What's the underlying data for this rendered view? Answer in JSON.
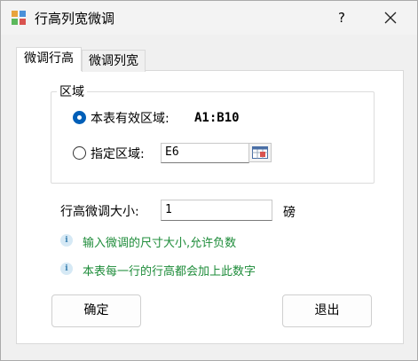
{
  "window": {
    "title": "行高列宽微调",
    "help_label": "?"
  },
  "tabs": [
    {
      "label": "微调行高",
      "active": true
    },
    {
      "label": "微调列宽",
      "active": false
    }
  ],
  "region_group": {
    "label": "区域",
    "option_effective_label": "本表有效区域:",
    "option_effective_value": "A1:B10",
    "option_effective_checked": true,
    "option_specified_label": "指定区域:",
    "option_specified_value": "E6",
    "option_specified_checked": false
  },
  "adjust": {
    "label": "行高微调大小:",
    "value": "1",
    "unit": "磅"
  },
  "hints": [
    "输入微调的尺寸大小,允许负数",
    "本表每一行的行高都会加上此数字"
  ],
  "buttons": {
    "ok": "确定",
    "exit": "退出"
  },
  "colors": {
    "accent": "#005fb8",
    "hint_text": "#1e8c3a"
  }
}
